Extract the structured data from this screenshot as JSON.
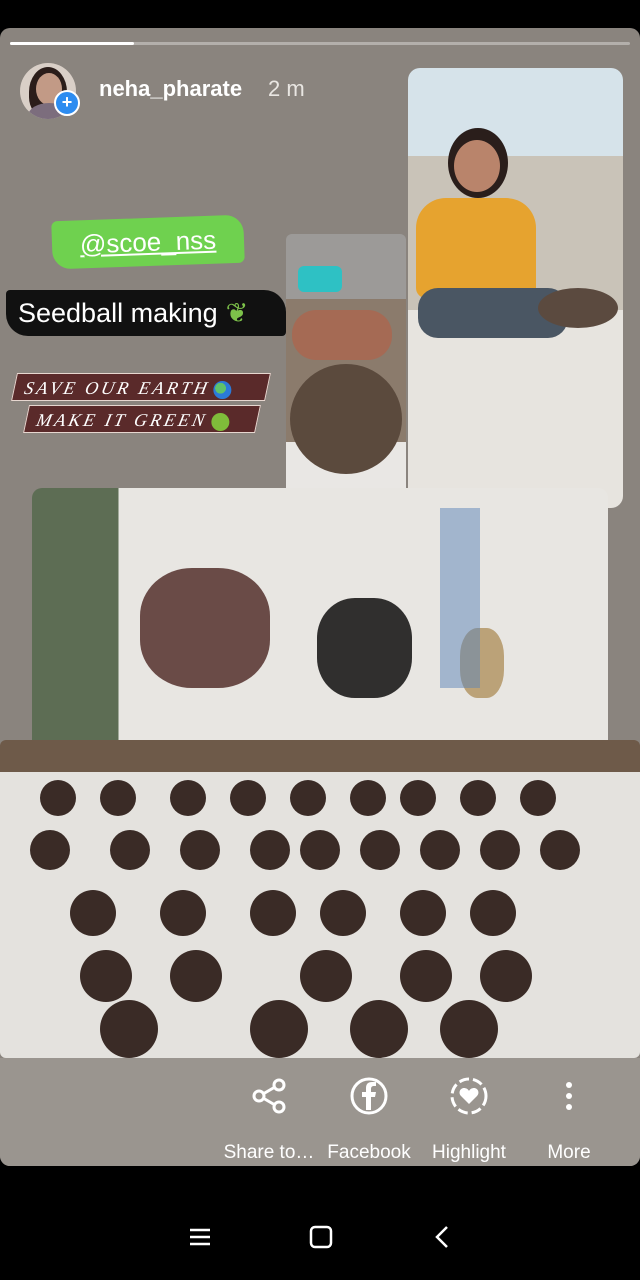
{
  "story": {
    "username": "neha_pharate",
    "time": "2 m",
    "progress": 0.2
  },
  "stickers": {
    "mention": "@scoe_nss",
    "title": "Seedball making",
    "tag_line_1": "SAVE OUR EARTH",
    "tag_line_2": "MAKE IT GREEN"
  },
  "actions": [
    {
      "label": "Share to…",
      "icon": "share-icon"
    },
    {
      "label": "Facebook",
      "icon": "facebook-icon"
    },
    {
      "label": "Highlight",
      "icon": "highlight-icon"
    },
    {
      "label": "More",
      "icon": "more-icon"
    }
  ],
  "navigation": {
    "menu_icon": "menu-icon",
    "home_icon": "home-icon",
    "back_icon": "back-icon"
  }
}
